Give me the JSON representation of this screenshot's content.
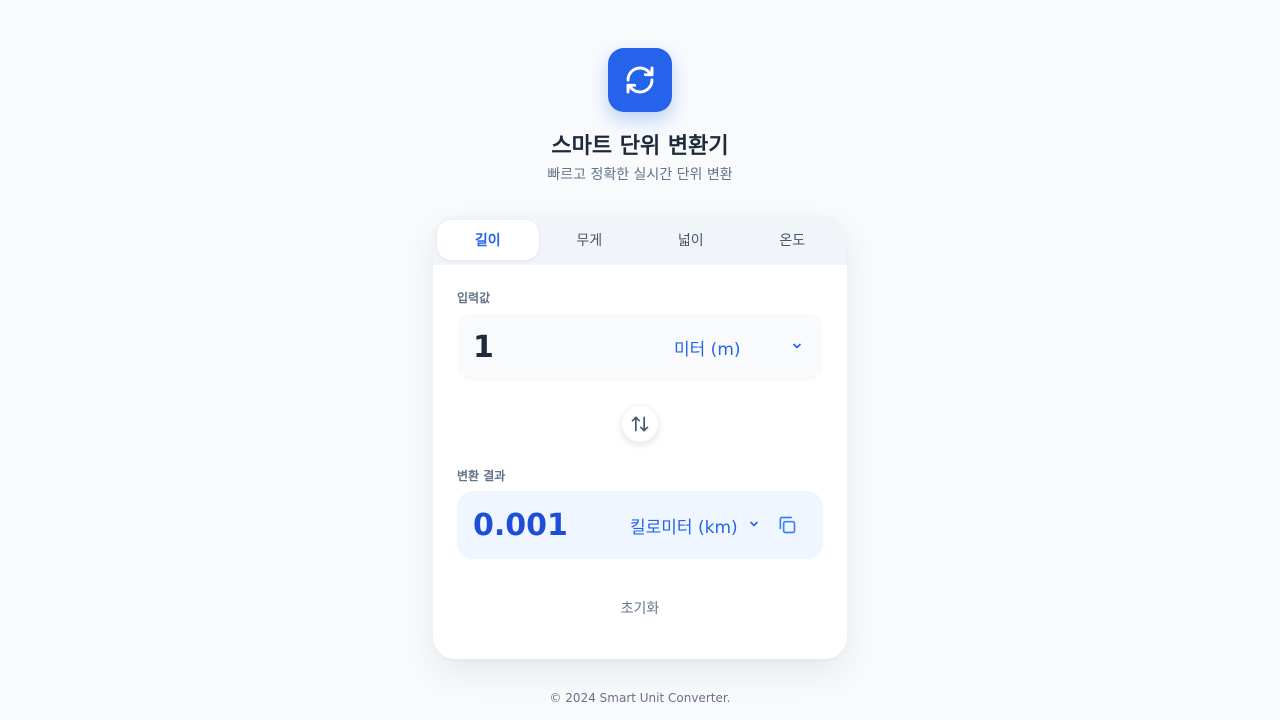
{
  "header": {
    "icon": "refresh-icon",
    "title": "스마트 단위 변환기",
    "subtitle": "빠르고 정확한 실시간 단위 변환"
  },
  "tabs": [
    {
      "label": "길이",
      "active": true
    },
    {
      "label": "무게",
      "active": false
    },
    {
      "label": "넓이",
      "active": false
    },
    {
      "label": "온도",
      "active": false
    }
  ],
  "input": {
    "label": "입력값",
    "value": "1",
    "unit": "미터 (m)"
  },
  "result": {
    "label": "변환 결과",
    "value": "0.001",
    "unit": "킬로미터 (km)"
  },
  "actions": {
    "reset_label": "초기화"
  },
  "footer": {
    "text": "© 2024 Smart Unit Converter."
  },
  "colors": {
    "accent": "#2563eb",
    "result_value": "#1d4ed8",
    "background": "#f8fafc"
  }
}
